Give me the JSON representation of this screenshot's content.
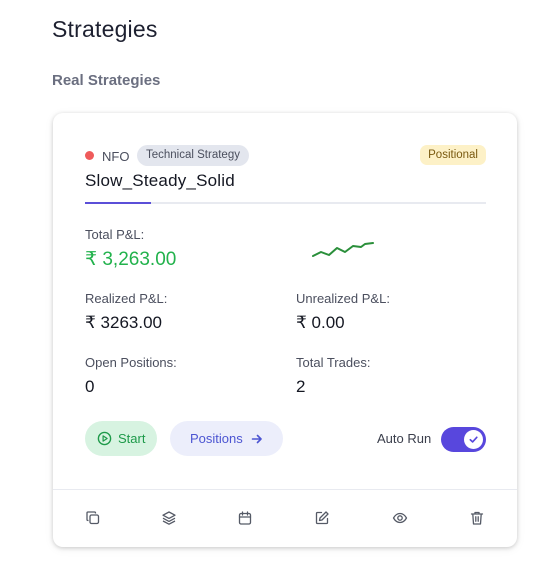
{
  "page": {
    "title": "Strategies",
    "section_title": "Real Strategies"
  },
  "card": {
    "exchange": "NFO",
    "strategy_type": "Technical Strategy",
    "badge": "Positional",
    "name": "Slow_Steady_Solid",
    "total_pnl_label": "Total P&L:",
    "total_pnl_value": "₹ 3,263.00",
    "realized_label": "Realized P&L:",
    "realized_value": "₹ 3263.00",
    "unrealized_label": "Unrealized P&L:",
    "unrealized_value": "₹ 0.00",
    "open_positions_label": "Open Positions:",
    "open_positions_value": "0",
    "total_trades_label": "Total Trades:",
    "total_trades_value": "2",
    "start_label": "Start",
    "positions_label": "Positions",
    "autorun_label": "Auto Run",
    "autorun_on": true
  },
  "colors": {
    "accent": "#5847dd",
    "positive": "#22b24c",
    "status_dot": "#ef5b5b"
  },
  "footer_icons": [
    "copy-icon",
    "layers-icon",
    "calendar-icon",
    "edit-icon",
    "eye-icon",
    "trash-icon"
  ]
}
